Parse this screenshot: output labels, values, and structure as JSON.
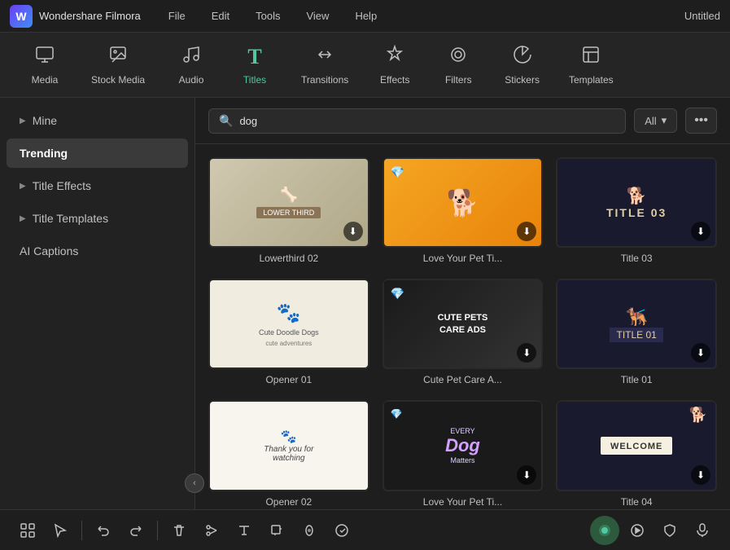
{
  "app": {
    "name": "Wondershare Filmora",
    "project": "Untitled"
  },
  "menu": {
    "items": [
      "File",
      "Edit",
      "Tools",
      "View",
      "Help"
    ]
  },
  "toolbar": {
    "items": [
      {
        "id": "media",
        "label": "Media",
        "icon": "⊞",
        "active": false
      },
      {
        "id": "stock-media",
        "label": "Stock Media",
        "icon": "📷",
        "active": false
      },
      {
        "id": "audio",
        "label": "Audio",
        "icon": "♪",
        "active": false
      },
      {
        "id": "titles",
        "label": "Titles",
        "icon": "T",
        "active": true
      },
      {
        "id": "transitions",
        "label": "Transitions",
        "icon": "↔",
        "active": false
      },
      {
        "id": "effects",
        "label": "Effects",
        "icon": "✦",
        "active": false
      },
      {
        "id": "filters",
        "label": "Filters",
        "icon": "◉",
        "active": false
      },
      {
        "id": "stickers",
        "label": "Stickers",
        "icon": "🎗",
        "active": false
      },
      {
        "id": "templates",
        "label": "Templates",
        "icon": "▭",
        "active": false
      }
    ]
  },
  "sidebar": {
    "items": [
      {
        "id": "mine",
        "label": "Mine",
        "hasArrow": true,
        "active": false
      },
      {
        "id": "trending",
        "label": "Trending",
        "hasArrow": false,
        "active": true
      },
      {
        "id": "title-effects",
        "label": "Title Effects",
        "hasArrow": true,
        "active": false
      },
      {
        "id": "title-templates",
        "label": "Title Templates",
        "hasArrow": true,
        "active": false
      },
      {
        "id": "ai-captions",
        "label": "AI Captions",
        "hasArrow": false,
        "active": false
      }
    ]
  },
  "search": {
    "placeholder": "dog",
    "value": "dog",
    "filter_label": "All",
    "more_icon": "•••"
  },
  "grid": {
    "items": [
      {
        "id": "lowerthird02",
        "label": "Lowerthird 02",
        "type": "lowerthird",
        "has_download": true
      },
      {
        "id": "lovepet1",
        "label": "Love Your Pet Ti...",
        "type": "lovepet",
        "has_download": true
      },
      {
        "id": "title03",
        "label": "Title 03",
        "type": "title03",
        "has_download": true
      },
      {
        "id": "opener01",
        "label": "Opener 01",
        "type": "opener01",
        "has_download": false
      },
      {
        "id": "cutepets",
        "label": "Cute Pet Care A...",
        "type": "cutepets",
        "has_download": true
      },
      {
        "id": "title01",
        "label": "Title 01",
        "type": "title01",
        "has_download": true
      },
      {
        "id": "opener02",
        "label": "Opener 02",
        "type": "opener02",
        "has_download": false
      },
      {
        "id": "lovepet2",
        "label": "Love Your Pet Ti...",
        "type": "lovepet2",
        "has_download": true
      },
      {
        "id": "title04",
        "label": "Title 04",
        "type": "title04",
        "has_download": true
      }
    ]
  },
  "bottom": {
    "buttons": [
      "grid-icon",
      "cursor-icon",
      "undo-icon",
      "redo-icon",
      "delete-icon",
      "scissors-icon",
      "text-icon",
      "crop-icon",
      "mask-icon",
      "more-icon"
    ]
  }
}
